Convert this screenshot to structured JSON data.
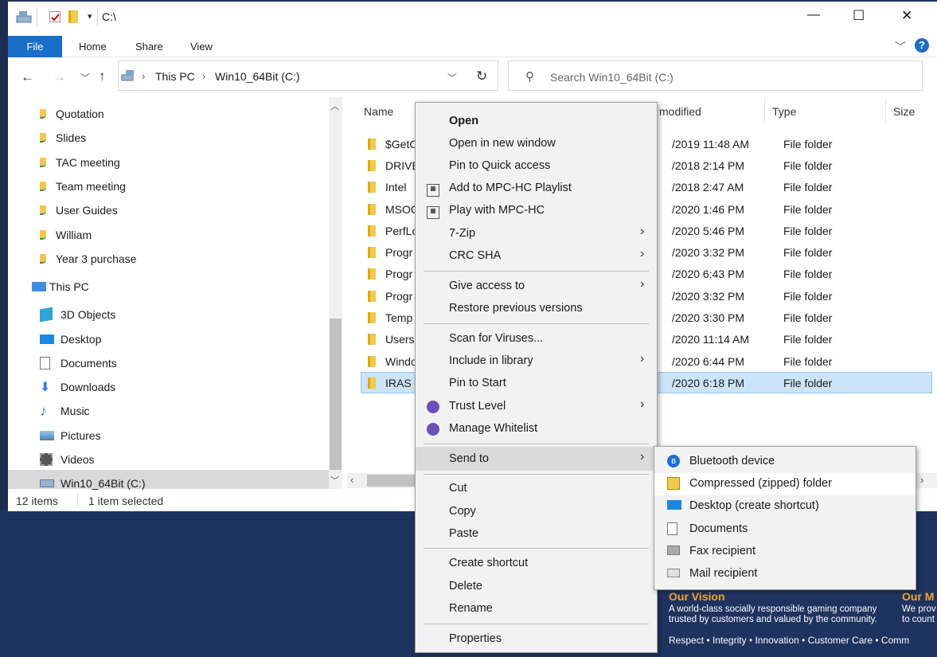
{
  "window": {
    "path_title": "C:\\",
    "controls": {
      "minimize": "—",
      "maximize": "☐",
      "close": "✕"
    }
  },
  "ribbon": {
    "tabs": [
      "File",
      "Home",
      "Share",
      "View"
    ]
  },
  "address": {
    "segments": [
      "This PC",
      "Win10_64Bit (C:)"
    ]
  },
  "search": {
    "placeholder": "Search Win10_64Bit (C:)"
  },
  "nav": {
    "items": [
      {
        "label": "Quotation",
        "icon": "synced-folder-icon"
      },
      {
        "label": "Slides",
        "icon": "synced-folder-icon"
      },
      {
        "label": "TAC meeting",
        "icon": "synced-folder-icon"
      },
      {
        "label": "Team meeting",
        "icon": "synced-folder-icon"
      },
      {
        "label": "User Guides",
        "icon": "synced-folder-icon"
      },
      {
        "label": "William",
        "icon": "synced-folder-icon"
      },
      {
        "label": "Year 3 purchase",
        "icon": "synced-folder-icon"
      },
      {
        "label": "This PC",
        "icon": "computer-icon"
      },
      {
        "label": "3D Objects",
        "icon": "cube-icon"
      },
      {
        "label": "Desktop",
        "icon": "desktop-icon"
      },
      {
        "label": "Documents",
        "icon": "document-icon"
      },
      {
        "label": "Downloads",
        "icon": "download-arrow-icon"
      },
      {
        "label": "Music",
        "icon": "music-note-icon"
      },
      {
        "label": "Pictures",
        "icon": "picture-icon"
      },
      {
        "label": "Videos",
        "icon": "film-icon"
      },
      {
        "label": "Win10_64Bit (C:)",
        "icon": "drive-icon"
      }
    ]
  },
  "columns": {
    "name": "Name",
    "modified": "modified",
    "type": "Type",
    "size": "Size"
  },
  "files": [
    {
      "name": "$GetC",
      "modified": "/2019 11:48 AM",
      "type": "File folder"
    },
    {
      "name": "DRIVE",
      "modified": "/2018 2:14 PM",
      "type": "File folder"
    },
    {
      "name": "Intel",
      "modified": "/2018 2:47 AM",
      "type": "File folder"
    },
    {
      "name": "MSOC",
      "modified": "/2020 1:46 PM",
      "type": "File folder"
    },
    {
      "name": "PerfLo",
      "modified": "/2020 5:46 PM",
      "type": "File folder"
    },
    {
      "name": "Progr",
      "modified": "/2020 3:32 PM",
      "type": "File folder"
    },
    {
      "name": "Progr",
      "modified": "/2020 6:43 PM",
      "type": "File folder"
    },
    {
      "name": "Progr",
      "modified": "/2020 3:32 PM",
      "type": "File folder"
    },
    {
      "name": "Temp",
      "modified": "/2020 3:30 PM",
      "type": "File folder"
    },
    {
      "name": "Users",
      "modified": "/2020 11:14 AM",
      "type": "File folder"
    },
    {
      "name": "Windo",
      "modified": "/2020 6:44 PM",
      "type": "File folder"
    },
    {
      "name": "IRAS",
      "modified": "/2020 6:18 PM",
      "type": "File folder"
    }
  ],
  "status": {
    "count": "12 items",
    "selected": "1 item selected"
  },
  "menu": {
    "open": "Open",
    "open_new": "Open in new window",
    "pin_quick": "Pin to Quick access",
    "add_mpc": "Add to MPC-HC Playlist",
    "play_mpc": "Play with MPC-HC",
    "zip7": "7-Zip",
    "crc": "CRC SHA",
    "give_access": "Give access to",
    "restore": "Restore previous versions",
    "scan": "Scan for Viruses...",
    "include": "Include in library",
    "pin_start": "Pin to Start",
    "trust": "Trust Level",
    "whitelist": "Manage Whitelist",
    "send_to": "Send to",
    "cut": "Cut",
    "copy": "Copy",
    "paste": "Paste",
    "shortcut": "Create shortcut",
    "delete": "Delete",
    "rename": "Rename",
    "properties": "Properties"
  },
  "submenu": {
    "bluetooth": "Bluetooth device",
    "zip": "Compressed (zipped) folder",
    "desktop": "Desktop (create shortcut)",
    "documents": "Documents",
    "fax": "Fax recipient",
    "mail": "Mail recipient"
  },
  "desktop": {
    "vision_title": "Our Vision",
    "vision_text_1": "A world-class socially responsible gaming company",
    "vision_text_2": "trusted by customers and valued by the community.",
    "mission_title": "Our M",
    "mission_text_1": "We prov",
    "mission_text_2": "to count",
    "values": "Respect • Integrity • Innovation • Customer Care • Comm"
  }
}
